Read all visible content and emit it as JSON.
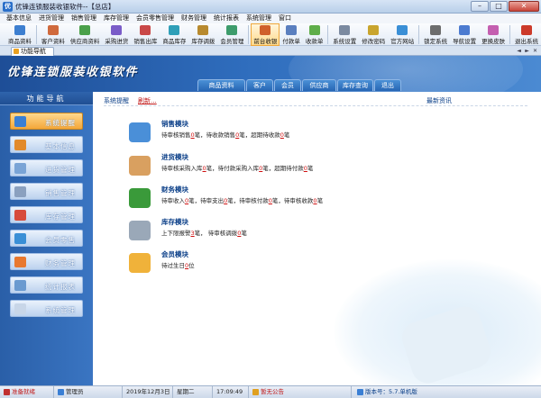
{
  "window": {
    "title": "优锋连锁服装收银软件--【总店】",
    "minimize": "–",
    "maximize": "□",
    "close": "✕"
  },
  "menu": [
    "基本信息",
    "进货管理",
    "销售管理",
    "库存管理",
    "会员零售管理",
    "财务管理",
    "统计报表",
    "系统管理",
    "窗口"
  ],
  "toolbar": [
    {
      "label": "商品资料",
      "color": "#3d7fd0"
    },
    {
      "label": "客户资料",
      "color": "#d06a3d"
    },
    {
      "label": "供应商资料",
      "color": "#4aa04a"
    },
    {
      "label": "采购进货",
      "color": "#7a5cc8"
    },
    {
      "label": "销售出库",
      "color": "#c94848"
    },
    {
      "label": "商品库存",
      "color": "#2f9fb8"
    },
    {
      "label": "库存调拨",
      "color": "#b88a2f"
    },
    {
      "label": "会员管理",
      "color": "#3d9c6c"
    },
    {
      "label": "前台收银",
      "color": "#d0602b",
      "active": true
    },
    {
      "label": "付款单",
      "color": "#5a7fbf"
    },
    {
      "label": "收款单",
      "color": "#5fae4a"
    },
    {
      "label": "系统设置",
      "color": "#7b8aa0"
    },
    {
      "label": "修改密码",
      "color": "#c9a52e"
    },
    {
      "label": "官方网站",
      "color": "#3a8fd6"
    },
    {
      "label": "锁定系统",
      "color": "#6d6d6d"
    },
    {
      "label": "导航设置",
      "color": "#4c7bd0"
    },
    {
      "label": "更换皮肤",
      "color": "#c45fb0"
    },
    {
      "label": "退出系统",
      "color": "#cc3a2a"
    }
  ],
  "tabs": {
    "active_doc_tab": "功能导航",
    "prev": "◄",
    "next": "►",
    "close": "✕"
  },
  "banner": {
    "brand": "优锋连锁服装收银软件",
    "nav_tabs": [
      "商品资料",
      "客户",
      "会员",
      "供应商",
      "库存查询",
      "退出"
    ]
  },
  "leftnav": {
    "title": "功能导航",
    "items": [
      {
        "label": "系统提醒",
        "color": "#3a7fd4",
        "selected": true
      },
      {
        "label": "基本信息",
        "color": "#e28a2b"
      },
      {
        "label": "进货管理",
        "color": "#7aa4d6"
      },
      {
        "label": "销售管理",
        "color": "#8aa0bf"
      },
      {
        "label": "库存管理",
        "color": "#d74b3c"
      },
      {
        "label": "会员零售",
        "color": "#3a8fd6"
      },
      {
        "label": "财务管理",
        "color": "#e8782f"
      },
      {
        "label": "统计报表",
        "color": "#6a9ad0"
      },
      {
        "label": "系统管理",
        "color": "#c8d6e8"
      }
    ]
  },
  "main": {
    "reminder": "系统提醒",
    "refresh": "刷新...",
    "news": "最新资讯",
    "modules": [
      {
        "title": "销售模块",
        "color": "#4a8fd8",
        "parts": [
          {
            "t": "待审核销售"
          },
          {
            "n": "0"
          },
          {
            "t": "笔，待收款销售"
          },
          {
            "n": "0"
          },
          {
            "t": "笔，超期待收款"
          },
          {
            "n": "0"
          },
          {
            "t": "笔"
          }
        ]
      },
      {
        "title": "进货模块",
        "color": "#d9a060",
        "parts": [
          {
            "t": "待审核采购入库"
          },
          {
            "n": "0"
          },
          {
            "t": "笔，待付款采购入库"
          },
          {
            "n": "0"
          },
          {
            "t": "笔，超期待付款"
          },
          {
            "n": "0"
          },
          {
            "t": "笔"
          }
        ]
      },
      {
        "title": "财务模块",
        "color": "#3a9a3a",
        "parts": [
          {
            "t": "待审收入"
          },
          {
            "n": "0"
          },
          {
            "t": "笔，待审支出"
          },
          {
            "n": "0"
          },
          {
            "t": "笔，待审核付款"
          },
          {
            "n": "0"
          },
          {
            "t": "笔，待审核收款"
          },
          {
            "n": "0"
          },
          {
            "t": "笔"
          }
        ]
      },
      {
        "title": "库存模块",
        "color": "#9aa8b8",
        "parts": [
          {
            "t": "上下限报警"
          },
          {
            "n": "3"
          },
          {
            "t": "笔，  待审核调拨"
          },
          {
            "n": "0"
          },
          {
            "t": "笔"
          }
        ]
      },
      {
        "title": "会员模块",
        "color": "#f0b23a",
        "parts": [
          {
            "t": "待过生日"
          },
          {
            "n": "0"
          },
          {
            "t": "位"
          }
        ]
      }
    ]
  },
  "status": {
    "state": "准备就绪",
    "user": "管理员",
    "date": "2019年12月3日",
    "weekday": "星期二",
    "time": "17:09:49",
    "notice": "暂无公告",
    "version": "版本号：5.7.单机版"
  }
}
